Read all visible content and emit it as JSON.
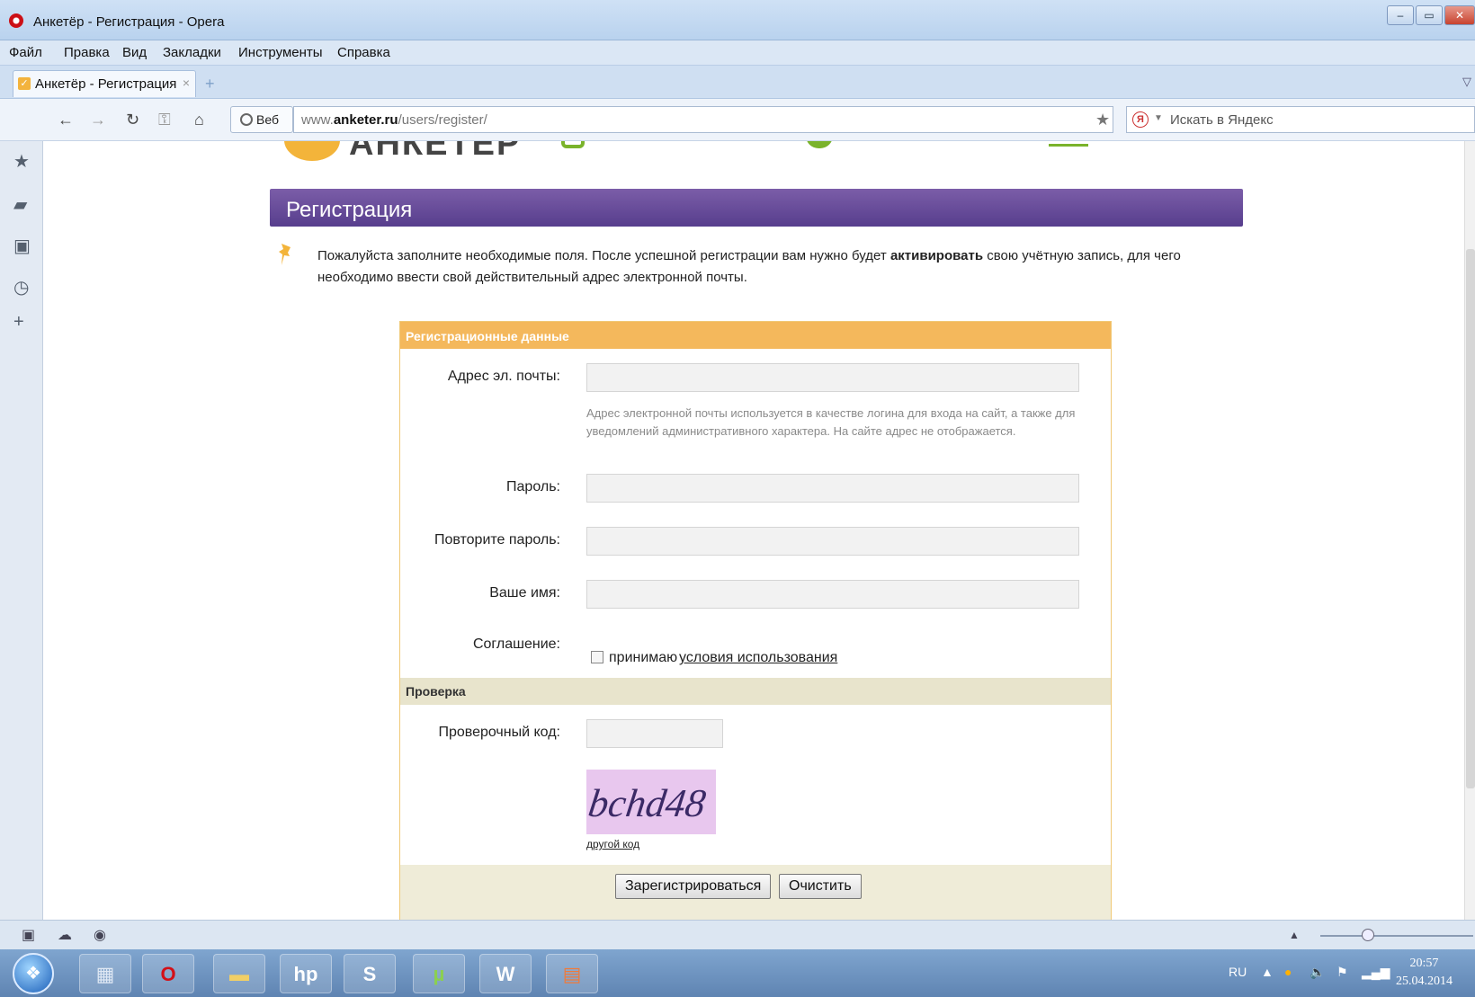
{
  "window": {
    "title": "Анкетёр - Регистрация - Opera",
    "minimize_glyph": "–",
    "maximize_glyph": "▭",
    "close_glyph": "✕"
  },
  "menu": {
    "items": [
      "Файл",
      "Правка",
      "Вид",
      "Закладки",
      "Инструменты",
      "Справка"
    ]
  },
  "tab": {
    "title": "Анкетёр - Регистрация",
    "close_glyph": "×",
    "new_tab_glyph": "+"
  },
  "address": {
    "web_label": "Веб",
    "url_prefix": "www.",
    "url_domain": "anketer.ru",
    "url_path": "/users/register/",
    "search_placeholder": "Искать в Яндекс",
    "search_engine_icon": "Я"
  },
  "icons": {
    "back": "←",
    "forward": "→",
    "reload": "↻",
    "key": "⚿",
    "home": "⌂",
    "star": "★",
    "side": [
      "★",
      "▰",
      "▣",
      "◷",
      "+"
    ]
  },
  "page": {
    "logo_text": "АНКЕТЁР",
    "heading": "Регистрация",
    "intro_before": "Пожалуйста заполните необходимые поля. После успешной регистрации вам нужно будет ",
    "intro_bold": "активировать",
    "intro_after": " свою учётную запись, для чего необходимо ввести свой действительный адрес электронной почты."
  },
  "form": {
    "section_registration": "Регистрационные данные",
    "email_label": "Адрес эл. почты:",
    "email_value": "",
    "email_hint": "Адрес электронной почты используется в качестве логина для входа на сайт, а также для уведомлений административного характера. На сайте адрес не отображается.",
    "password_label": "Пароль:",
    "password_value": "",
    "repeat_label": "Повторите пароль:",
    "repeat_value": "",
    "name_label": "Ваше имя:",
    "name_value": "",
    "agreement_label": "Соглашение:",
    "agree_text": "принимаю",
    "agree_link": "условия использования",
    "agree_checked": false,
    "section_check": "Проверка",
    "captcha_label": "Проверочный код:",
    "captcha_value": "",
    "captcha_image_text": "bchd48",
    "other_code": "другой код",
    "register_button": "Зарегистрироваться",
    "clear_button": "Очистить"
  },
  "taskbar": {
    "apps": [
      "calculator-icon",
      "opera-icon",
      "explorer-icon",
      "hp-icon",
      "skype-icon",
      "utorrent-icon",
      "word-icon",
      "presentation-icon"
    ],
    "lang": "RU",
    "time": "20:57",
    "date": "25.04.2014"
  },
  "colors": {
    "header_purple": "#6a4f9c",
    "section_orange": "#f4b85c",
    "section_tan": "#e8e4cc",
    "captcha_bg": "#e8c7ee"
  }
}
